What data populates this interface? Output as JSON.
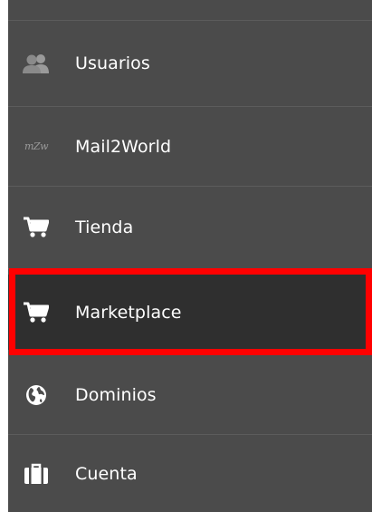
{
  "sidebar": {
    "items": [
      {
        "label": "Usuarios",
        "icon": "users-icon"
      },
      {
        "label": "Mail2World",
        "icon": "mail2world-logo-icon",
        "icon_text": "mZw"
      },
      {
        "label": "Tienda",
        "icon": "cart-icon"
      },
      {
        "label": "Marketplace",
        "icon": "cart-icon",
        "active": true
      },
      {
        "label": "Dominios",
        "icon": "globe-icon"
      },
      {
        "label": "Cuenta",
        "icon": "briefcase-icon"
      }
    ]
  },
  "colors": {
    "background": "#4b4b4b",
    "active_background": "#2f2f2f",
    "highlight": "#ff0000",
    "text": "#ffffff",
    "icon_muted": "#9a9a9a"
  }
}
